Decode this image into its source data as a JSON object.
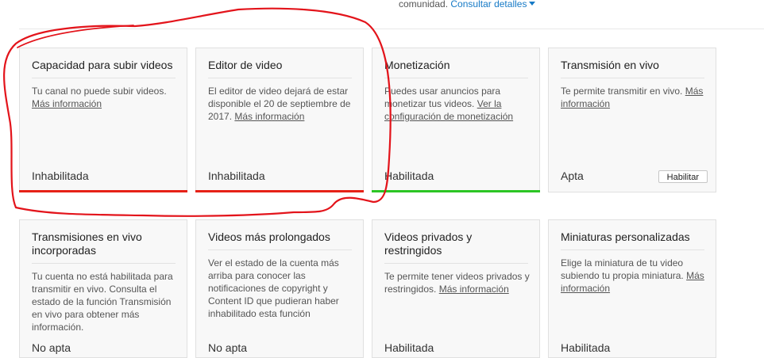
{
  "header": {
    "text": "comunidad.",
    "link": "Consultar detalles"
  },
  "colors": {
    "disabled": "#e62117",
    "enabled": "#2cc524",
    "link": "#167ac6",
    "annotation": "#e3141b"
  },
  "cards": [
    {
      "title": "Capacidad para subir videos",
      "desc": "Tu canal no puede subir videos.",
      "link": "Más información",
      "status": "Inhabilitada",
      "bar": "red"
    },
    {
      "title": "Editor de video",
      "desc": "El editor de video dejará de estar disponible el 20 de septiembre de 2017.",
      "link": "Más información",
      "status": "Inhabilitada",
      "bar": "red"
    },
    {
      "title": "Monetización",
      "desc": "Puedes usar anuncios para monetizar tus videos.",
      "link": "Ver la configuración de monetización",
      "status": "Habilitada",
      "bar": "green"
    },
    {
      "title": "Transmisión en vivo",
      "desc": "Te permite transmitir en vivo.",
      "link": "Más información",
      "status": "Apta",
      "button": "Habilitar"
    },
    {
      "title": "Transmisiones en vivo incorporadas",
      "desc": "Tu cuenta no está habilitada para transmitir en vivo. Consulta el estado de la función Transmisión en vivo para obtener más información.",
      "status": "No apta"
    },
    {
      "title": "Videos más prolongados",
      "desc": "Ver el estado de la cuenta más arriba para conocer las notificaciones de copyright y Content ID que pudieran haber inhabilitado esta función",
      "status": "No apta"
    },
    {
      "title": "Videos privados y restringidos",
      "desc": "Te permite tener videos privados y restringidos.",
      "link": "Más información",
      "status": "Habilitada"
    },
    {
      "title": "Miniaturas personalizadas",
      "desc": "Elige la miniatura de tu video subiendo tu propia miniatura.",
      "link": "Más información",
      "status": "Habilitada"
    }
  ]
}
